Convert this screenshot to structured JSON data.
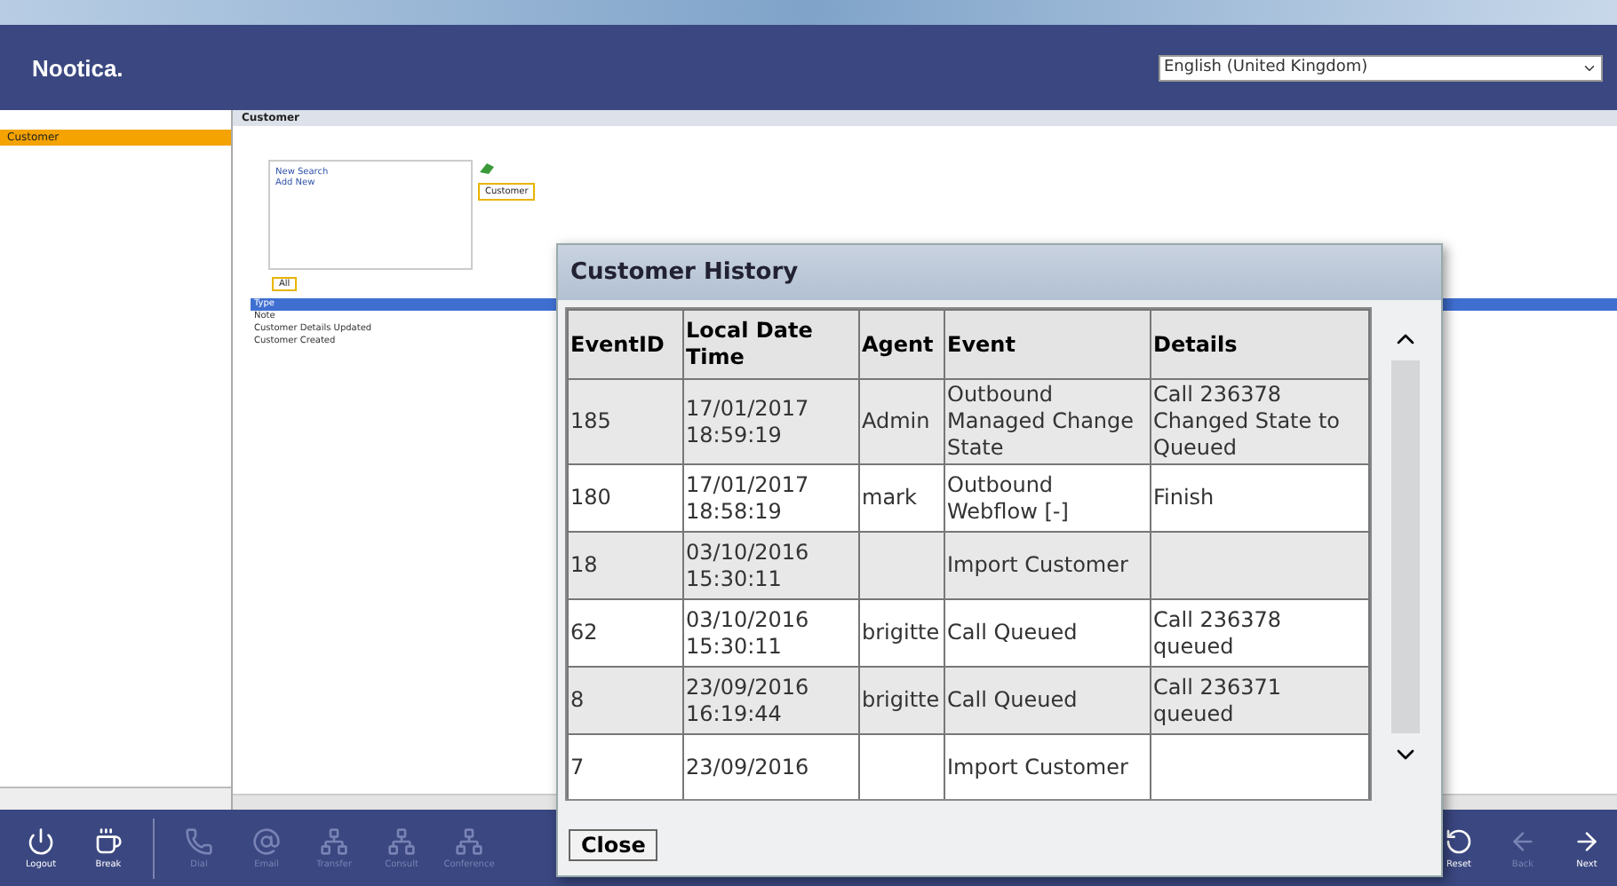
{
  "header": {
    "logo": "Nootica.",
    "language": "English (United Kingdom)"
  },
  "sidebar": {
    "items": [
      {
        "label": "Customer",
        "selected": true
      }
    ]
  },
  "main": {
    "title": "Customer",
    "search_links": [
      "New Search",
      "Add New"
    ],
    "entity_tab": "Customer",
    "filter_tab": "All",
    "list": [
      {
        "label": "Type",
        "selected": true
      },
      {
        "label": "Note",
        "selected": false
      },
      {
        "label": "Customer Details Updated",
        "selected": false
      },
      {
        "label": "Customer Created",
        "selected": false
      }
    ]
  },
  "toolbar": {
    "left": [
      {
        "kind": "power",
        "label": "Logout",
        "disabled": false
      },
      {
        "kind": "coffee",
        "label": "Break",
        "disabled": false
      }
    ],
    "middle": [
      {
        "kind": "phone",
        "label": "Dial",
        "disabled": true
      },
      {
        "kind": "at",
        "label": "Email",
        "disabled": true
      },
      {
        "kind": "network",
        "label": "Transfer",
        "disabled": true
      },
      {
        "kind": "network",
        "label": "Consult",
        "disabled": true
      },
      {
        "kind": "network",
        "label": "Conference",
        "disabled": true
      }
    ],
    "right": [
      {
        "kind": "reset",
        "label": "Reset",
        "disabled": false
      },
      {
        "kind": "back",
        "label": "Back",
        "disabled": true
      },
      {
        "kind": "next",
        "label": "Next",
        "disabled": false
      }
    ]
  },
  "dialog": {
    "title": "Customer History",
    "columns": [
      "EventID",
      "Local Date Time",
      "Agent",
      "Event",
      "Details"
    ],
    "rows": [
      [
        "185",
        "17/01/2017 18:59:19",
        "Admin",
        "Outbound Managed Change State",
        "Call 236378 Changed State to Queued"
      ],
      [
        "180",
        "17/01/2017 18:58:19",
        "mark",
        "Outbound Webflow [-]",
        "Finish"
      ],
      [
        "18",
        "03/10/2016 15:30:11",
        "",
        "Import Customer",
        ""
      ],
      [
        "62",
        "03/10/2016 15:30:11",
        "brigitte",
        "Call Queued",
        "Call 236378 queued"
      ],
      [
        "8",
        "23/09/2016 16:19:44",
        "brigitte",
        "Call Queued",
        "Call 236371 queued"
      ],
      [
        "7",
        "23/09/2016",
        "",
        "Import Customer",
        ""
      ]
    ],
    "close": "Close"
  }
}
